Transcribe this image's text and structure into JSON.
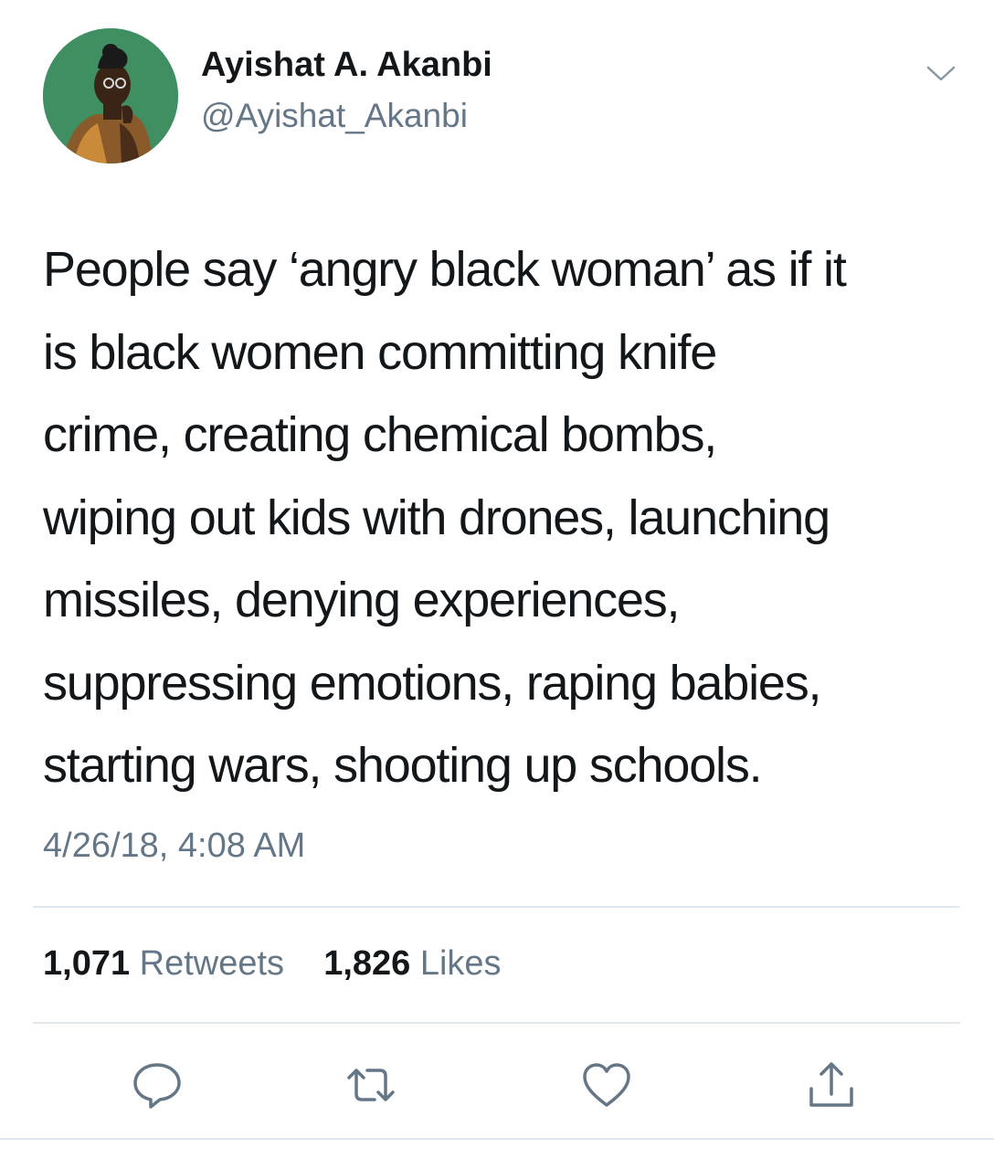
{
  "author": {
    "display_name": "Ayishat A. Akanbi",
    "handle": "@Ayishat_Akanbi",
    "avatar_icon": "profile-photo"
  },
  "tweet": {
    "lines": [
      "People say ‘angry black woman’ as if it",
      "is black women committing knife",
      "crime, creating chemical bombs,",
      "wiping out kids with drones, launching",
      "missiles, denying experiences,",
      "suppressing emotions, raping babies,",
      "starting wars, shooting up schools."
    ],
    "timestamp": "4/26/18, 4:08 AM"
  },
  "stats": {
    "retweets_count": "1,071",
    "retweets_label": "Retweets",
    "likes_count": "1,826",
    "likes_label": "Likes"
  },
  "actions": [
    "reply-icon",
    "retweet-icon",
    "like-icon",
    "share-icon"
  ],
  "colors": {
    "text_primary": "#14171a",
    "text_secondary": "#657786",
    "divider": "#e1e8ed",
    "icon": "#657786"
  }
}
